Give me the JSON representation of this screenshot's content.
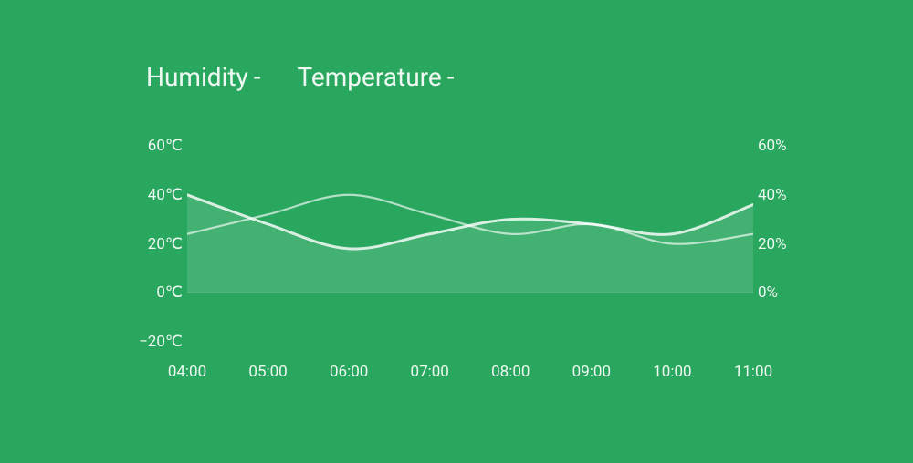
{
  "title": {
    "humidity_label": "Humidity",
    "humidity_value": "-",
    "temperature_label": "Temperature",
    "temperature_value": "-"
  },
  "chart_data": {
    "type": "line",
    "x": [
      "04:00",
      "05:00",
      "06:00",
      "07:00",
      "08:00",
      "09:00",
      "10:00",
      "11:00"
    ],
    "series": [
      {
        "name": "Humidity",
        "axis": "right",
        "unit": "%",
        "values": [
          40,
          28,
          18,
          24,
          30,
          28,
          24,
          36
        ]
      },
      {
        "name": "Temperature",
        "axis": "left",
        "unit": "°C",
        "values": [
          24,
          32,
          40,
          32,
          24,
          28,
          20,
          24
        ]
      }
    ],
    "left_axis": {
      "label": "",
      "unit": "℃",
      "ticks": [
        60,
        40,
        20,
        0,
        -20
      ],
      "range": [
        -20,
        60
      ]
    },
    "right_axis": {
      "label": "",
      "unit": "%",
      "ticks": [
        60,
        40,
        20,
        0
      ],
      "range": [
        -20,
        60
      ]
    },
    "grid": false,
    "legend": "top"
  },
  "colors": {
    "bg": "#2aa75e",
    "line": "rgba(255,255,255,0.85)",
    "fill": "rgba(255,255,255,0.12)",
    "text": "#ffffff"
  }
}
